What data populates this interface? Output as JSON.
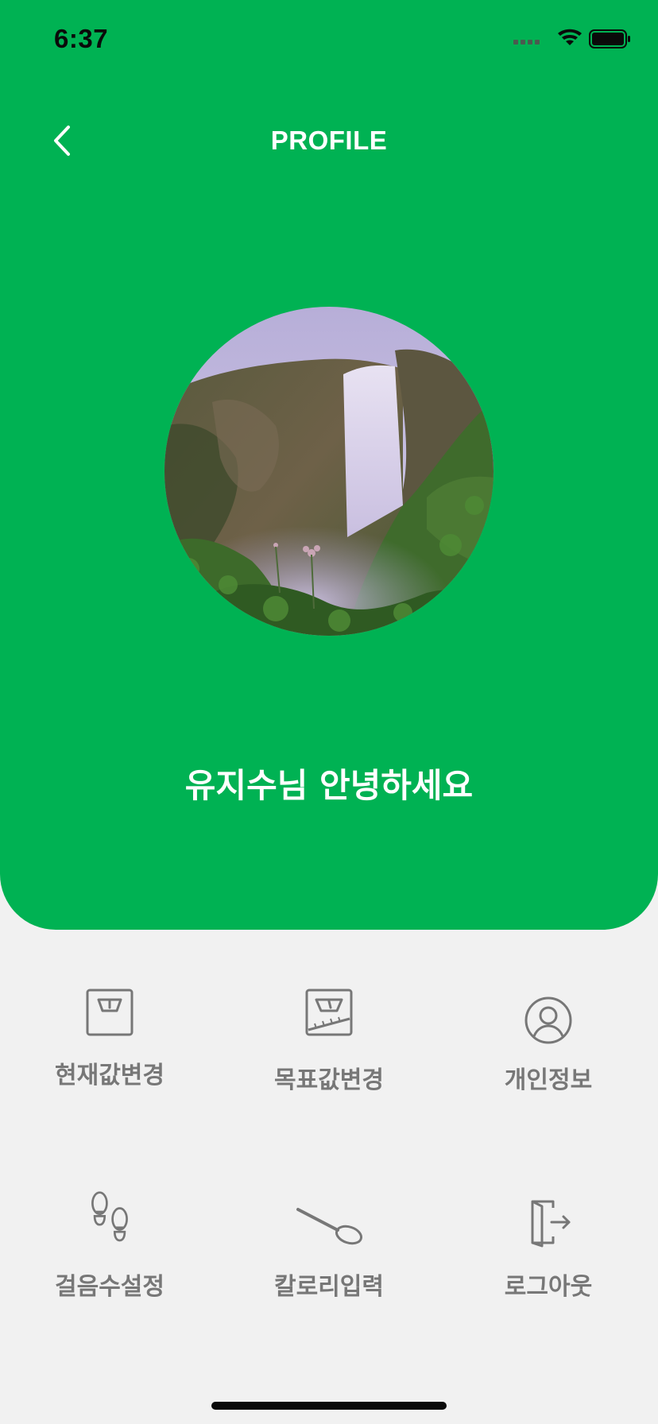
{
  "status_bar": {
    "time": "6:37"
  },
  "header": {
    "title": "PROFILE",
    "back_icon": "chevron-left-icon"
  },
  "profile": {
    "avatar_description": "",
    "greeting": "유지수님 안녕하세요"
  },
  "menu": {
    "items": [
      {
        "label": "현재값변경",
        "icon": "scale-icon"
      },
      {
        "label": "목표값변경",
        "icon": "target-scale-icon"
      },
      {
        "label": "개인정보",
        "icon": "user-circle-icon"
      },
      {
        "label": "걸음수설정",
        "icon": "footprints-icon"
      },
      {
        "label": "칼로리입력",
        "icon": "spoon-icon"
      },
      {
        "label": "로그아웃",
        "icon": "logout-icon"
      }
    ]
  },
  "colors": {
    "primary_green": "#00b253",
    "background": "#f1f1f1",
    "menu_gray": "#777777",
    "text_white": "#ffffff"
  }
}
